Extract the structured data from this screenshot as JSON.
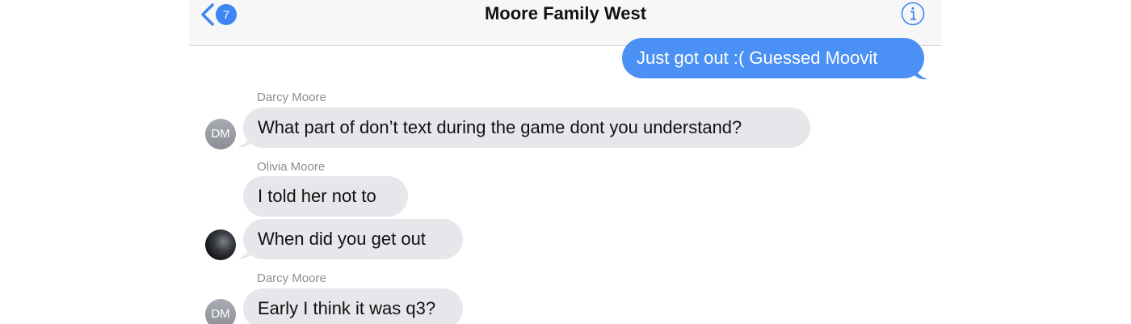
{
  "navbar": {
    "title": "Moore Family West",
    "back_badge": "7",
    "back_icon": "chevron-left-icon",
    "info_icon": "info-icon",
    "accent_color": "#3f86f4"
  },
  "messages": [
    {
      "direction": "outgoing",
      "text": "Just got out :( Guessed Moovit"
    },
    {
      "direction": "incoming",
      "sender": "Darcy Moore",
      "avatar": "DM",
      "text": "What part of don’t text during the game dont you understand?"
    },
    {
      "direction": "incoming",
      "sender": "Olivia Moore",
      "text": "I told her not to"
    },
    {
      "direction": "incoming",
      "avatar_type": "photo",
      "text": "When did you get out"
    },
    {
      "direction": "incoming",
      "sender": "Darcy Moore",
      "avatar": "DM",
      "text": "Early I think it was q3?"
    }
  ],
  "colors": {
    "outgoing_bubble": "#4a90f5",
    "incoming_bubble": "#e6e6eb",
    "sender_label": "#8e8e93"
  }
}
